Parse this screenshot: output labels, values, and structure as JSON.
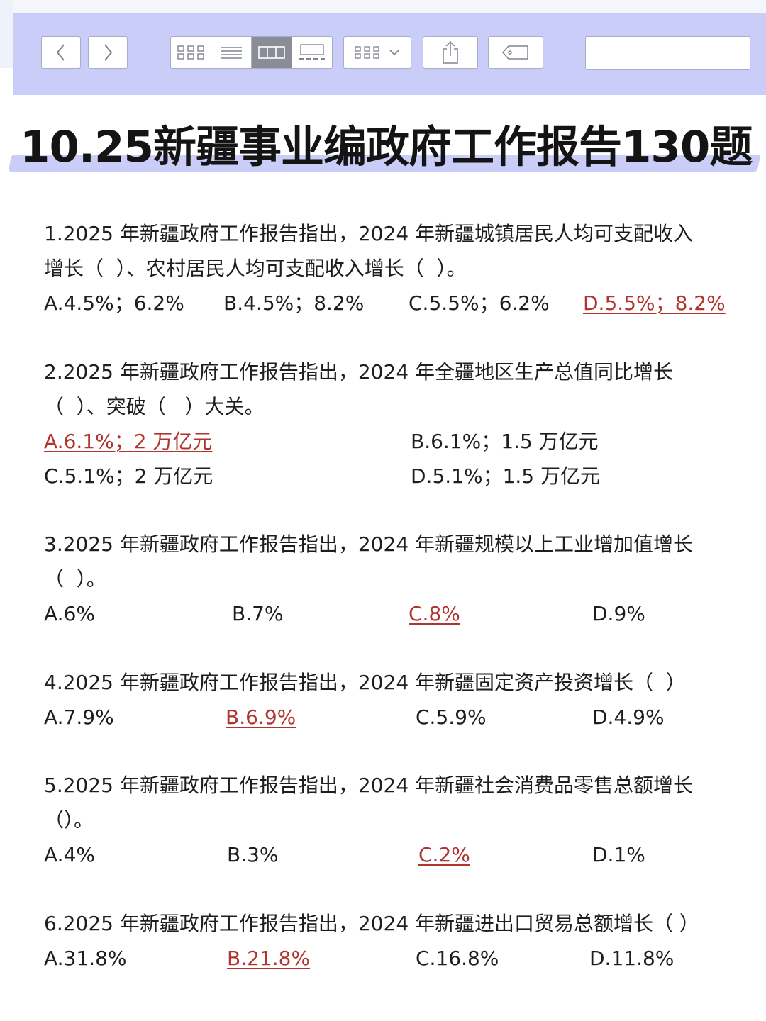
{
  "toolbar": {
    "back_icon": "chevron-left-icon",
    "forward_icon": "chevron-right-icon",
    "view_modes": [
      "icon-view",
      "list-view",
      "column-view",
      "gallery-view"
    ],
    "active_view": "column-view",
    "group_icon": "group-by-icon",
    "share_icon": "share-icon",
    "tag_icon": "tag-icon",
    "search_placeholder": "",
    "accent_color": "#c9cdf8"
  },
  "title": "10.25新疆事业编政府工作报告130题",
  "questions": [
    {
      "lines": [
        "1.2025 年新疆政府工作报告指出，2024 年新疆城镇居民人均可支配收入",
        "增长（  ）、农村居民人均可支配收入增长（  ）。"
      ],
      "options": [
        {
          "label": "A.4.5%；6.2%",
          "correct": false
        },
        {
          "label": "B.4.5%；8.2%",
          "correct": false
        },
        {
          "label": "C.5.5%；6.2%",
          "correct": false
        },
        {
          "label": "D.5.5%；8.2%",
          "correct": true
        }
      ]
    },
    {
      "lines": [
        "2.2025 年新疆政府工作报告指出，2024 年全疆地区生产总值同比增长",
        "（  ）、突破（   ）大关。"
      ],
      "options": [
        {
          "label": "A.6.1%；2 万亿元",
          "correct": true
        },
        {
          "label": "B.6.1%；1.5 万亿元",
          "correct": false
        },
        {
          "label": "C.5.1%；2 万亿元",
          "correct": false
        },
        {
          "label": "D.5.1%；1.5 万亿元",
          "correct": false
        }
      ]
    },
    {
      "lines": [
        "3.2025 年新疆政府工作报告指出，2024 年新疆规模以上工业增加值增长",
        "（  ）。"
      ],
      "options": [
        {
          "label": "A.6%",
          "correct": false
        },
        {
          "label": "B.7%",
          "correct": false
        },
        {
          "label": "C.8%",
          "correct": true
        },
        {
          "label": "D.9%",
          "correct": false
        }
      ]
    },
    {
      "lines": [
        "4.2025 年新疆政府工作报告指出，2024 年新疆固定资产投资增长（  ）"
      ],
      "options": [
        {
          "label": "A.7.9%",
          "correct": false
        },
        {
          "label": "B.6.9%",
          "correct": true
        },
        {
          "label": "C.5.9%",
          "correct": false
        },
        {
          "label": "D.4.9%",
          "correct": false
        }
      ]
    },
    {
      "lines": [
        "5.2025 年新疆政府工作报告指出，2024 年新疆社会消费品零售总额增长",
        "（）。"
      ],
      "options": [
        {
          "label": "A.4%",
          "correct": false
        },
        {
          "label": "B.3%",
          "correct": false
        },
        {
          "label": "C.2%",
          "correct": true
        },
        {
          "label": "D.1%",
          "correct": false
        }
      ]
    },
    {
      "lines": [
        "6.2025 年新疆政府工作报告指出，2024 年新疆进出口贸易总额增长（ ）"
      ],
      "options": [
        {
          "label": "A.31.8%",
          "correct": false
        },
        {
          "label": "B.21.8%",
          "correct": true
        },
        {
          "label": "C.16.8%",
          "correct": false
        },
        {
          "label": "D.11.8%",
          "correct": false
        }
      ]
    }
  ]
}
